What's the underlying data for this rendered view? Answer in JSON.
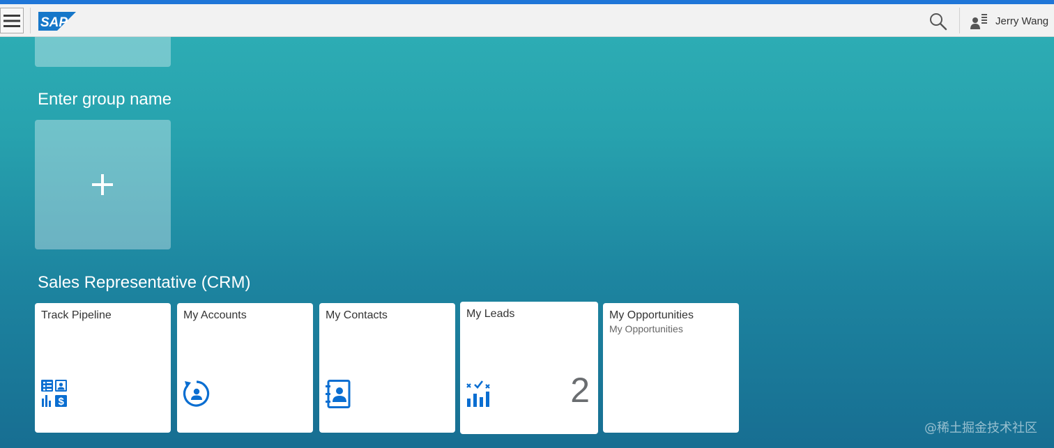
{
  "shell": {
    "logo_text": "SAP",
    "user_name": "Jerry Wang",
    "icons": [
      "menu-icon",
      "sap-logo",
      "search-icon",
      "user-profile-icon"
    ],
    "colors": {
      "top_line": "#1f76d8",
      "shell_bar": "#f2f2f2",
      "logo_blue": "#1677c9"
    }
  },
  "groups": [
    {
      "title": "Enter group name",
      "tiles": [
        {
          "type": "add-tile",
          "label": "+"
        }
      ]
    },
    {
      "title": "Sales Representative (CRM)",
      "tiles": [
        {
          "title": "Track Pipeline",
          "subtitle": "",
          "icon": "pipeline-composite-icon",
          "number": ""
        },
        {
          "title": "My Accounts",
          "subtitle": "",
          "icon": "account-refresh-icon",
          "number": ""
        },
        {
          "title": "My Contacts",
          "subtitle": "",
          "icon": "address-book-icon",
          "number": ""
        },
        {
          "title": "My Leads",
          "subtitle": "",
          "icon": "leads-chart-icon",
          "number": "2"
        },
        {
          "title": "My Opportunities",
          "subtitle": "My Opportunities",
          "icon": "",
          "number": ""
        }
      ]
    }
  ],
  "watermark": "@稀土掘金技术社区",
  "theme": {
    "icon_blue": "#0a6ed1",
    "tile_bg": "#ffffff",
    "title_color": "#333333"
  }
}
